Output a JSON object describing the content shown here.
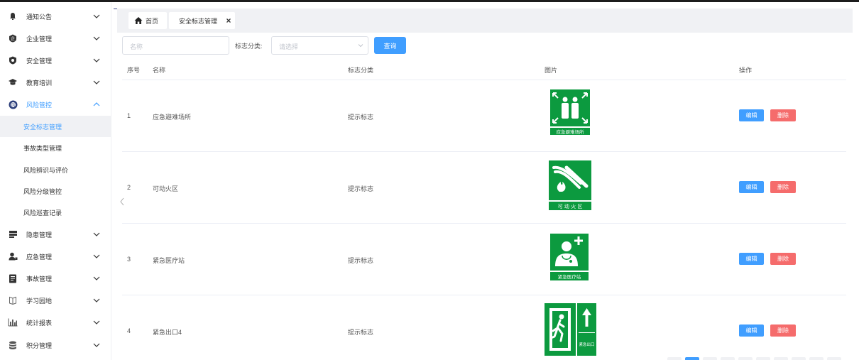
{
  "sidebar": {
    "items": [
      {
        "label": "通知公告",
        "icon": "bell-icon"
      },
      {
        "label": "企业管理",
        "icon": "enterprise-shield-icon"
      },
      {
        "label": "安全管理",
        "icon": "safety-shield-icon"
      },
      {
        "label": "教育培训",
        "icon": "graduation-cap-icon"
      },
      {
        "label": "风险管控",
        "icon": "risk-badge-icon",
        "expanded": true
      },
      {
        "label": "隐患管理",
        "icon": "stack-icon"
      },
      {
        "label": "应急管理",
        "icon": "person-icon"
      },
      {
        "label": "事故管理",
        "icon": "document-icon"
      },
      {
        "label": "学习园地",
        "icon": "book-icon"
      },
      {
        "label": "统计报表",
        "icon": "bar-chart-icon"
      },
      {
        "label": "积分管理",
        "icon": "database-icon"
      }
    ],
    "sub_items": [
      {
        "label": "安全标志管理",
        "selected": true
      },
      {
        "label": "事故类型管理"
      },
      {
        "label": "风险辨识与评价"
      },
      {
        "label": "风险分级管控"
      },
      {
        "label": "风险巡查记录"
      }
    ]
  },
  "tabs": {
    "home": "首页",
    "current": "安全标志管理"
  },
  "filters": {
    "name_placeholder": "名称",
    "category_label": "标志分类:",
    "category_placeholder": "请选择",
    "query_button": "查询"
  },
  "table": {
    "headers": [
      "序号",
      "名称",
      "标志分类",
      "图片",
      "操作"
    ],
    "rows": [
      {
        "index": "1",
        "name": "应急避难场所",
        "category": "提示标志",
        "sign_caption": "应急避难场所"
      },
      {
        "index": "2",
        "name": "可动火区",
        "category": "提示标志",
        "sign_caption": "可 动 火 区"
      },
      {
        "index": "3",
        "name": "紧急医疗站",
        "category": "提示标志",
        "sign_caption": "紧急医疗站"
      },
      {
        "index": "4",
        "name": "紧急出口4",
        "category": "提示标志",
        "sign_caption": "紧急出口"
      }
    ],
    "edit_label": "编辑",
    "delete_label": "删除"
  },
  "colors": {
    "primary": "#409eff",
    "danger": "#f56c6c",
    "sign_green": "#0c9a3f"
  }
}
